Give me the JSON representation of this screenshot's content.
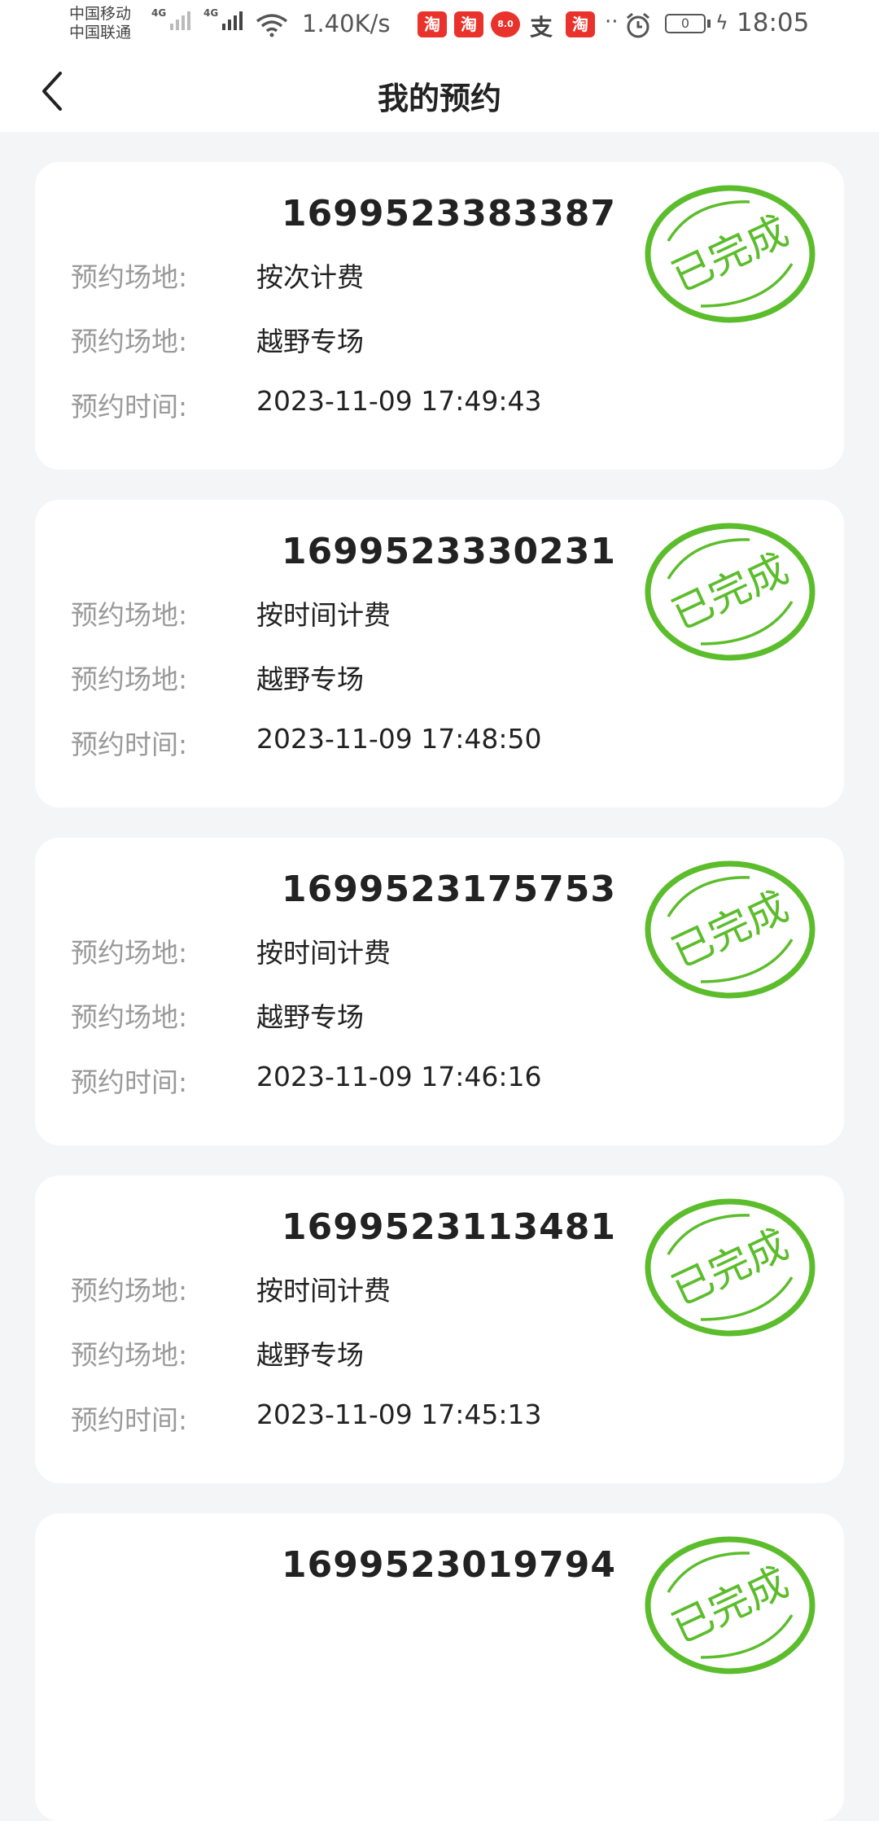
{
  "status_bar": {
    "carrier_1": "中国移动",
    "carrier_2": "中国联通",
    "network_1": "4G",
    "network_2": "4G",
    "speed": "1.40K/s",
    "app_icon_1": "淘",
    "app_icon_2": "淘",
    "app_icon_3": "8.0",
    "app_icon_4": "支",
    "app_icon_5": "淘",
    "dots": "··",
    "battery_level": "0",
    "time": "18:05",
    "icons": [
      "signal-icon",
      "wifi-icon",
      "alarm-icon",
      "battery-icon",
      "charging-icon"
    ]
  },
  "nav": {
    "title": "我的预约",
    "back_icon": "chevron-left-icon"
  },
  "theme": {
    "stamp_color": "#5cbd2c",
    "background": "#f4f5f7"
  },
  "reservations": [
    {
      "id": "1699523383387",
      "label_1": "预约场地:",
      "value_1": "按次计费",
      "label_2": "预约场地:",
      "value_2": "越野专场",
      "label_3": "预约时间:",
      "value_3": "2023-11-09 17:49:43",
      "status": "已完成"
    },
    {
      "id": "1699523330231",
      "label_1": "预约场地:",
      "value_1": "按时间计费",
      "label_2": "预约场地:",
      "value_2": "越野专场",
      "label_3": "预约时间:",
      "value_3": "2023-11-09 17:48:50",
      "status": "已完成"
    },
    {
      "id": "1699523175753",
      "label_1": "预约场地:",
      "value_1": "按时间计费",
      "label_2": "预约场地:",
      "value_2": "越野专场",
      "label_3": "预约时间:",
      "value_3": "2023-11-09 17:46:16",
      "status": "已完成"
    },
    {
      "id": "1699523113481",
      "label_1": "预约场地:",
      "value_1": "按时间计费",
      "label_2": "预约场地:",
      "value_2": "越野专场",
      "label_3": "预约时间:",
      "value_3": "2023-11-09 17:45:13",
      "status": "已完成"
    },
    {
      "id": "1699523019794",
      "label_1": "",
      "value_1": "",
      "label_2": "",
      "value_2": "",
      "label_3": "",
      "value_3": "",
      "status": "已完成"
    }
  ]
}
